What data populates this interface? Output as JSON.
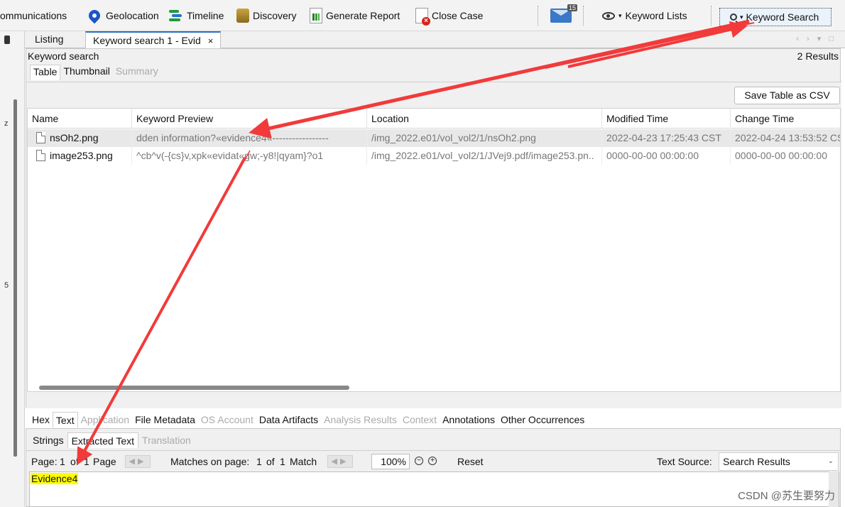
{
  "toolbar": {
    "items": [
      {
        "label": "ommunications",
        "icon": "communications-icon"
      },
      {
        "label": "Geolocation",
        "icon": "geolocation-pin-icon"
      },
      {
        "label": "Timeline",
        "icon": "timeline-icon"
      },
      {
        "label": "Discovery",
        "icon": "discovery-icon"
      },
      {
        "label": "Generate Report",
        "icon": "report-icon"
      },
      {
        "label": "Close Case",
        "icon": "close-case-icon"
      }
    ],
    "mail_badge": "15",
    "keyword_lists": "Keyword Lists",
    "keyword_search": "Keyword Search"
  },
  "left_strip": {
    "glyphs": [
      "z",
      "5"
    ]
  },
  "tabs": {
    "listing": "Listing",
    "active": "Keyword search 1 - Evid",
    "close": "×",
    "nav": "‹ › ▾ □"
  },
  "results": {
    "title": "Keyword search",
    "count": "2  Results",
    "subtabs": [
      {
        "label": "Table",
        "state": "active"
      },
      {
        "label": "Thumbnail",
        "state": "normal"
      },
      {
        "label": "Summary",
        "state": "disabled"
      }
    ],
    "save_csv": "Save Table as CSV",
    "columns": [
      "Name",
      "Keyword Preview",
      "Location",
      "Modified Time",
      "Change Time"
    ],
    "rows": [
      {
        "name": "nsOh2.png",
        "preview": "dden information?«evidence4«-----------------",
        "location": "/img_2022.e01/vol_vol2/1/nsOh2.png",
        "modified": "2022-04-23 17:25:43 CST",
        "changed": "2022-04-24 13:53:52 CS"
      },
      {
        "name": "image253.png",
        "preview": "^cb^v(-{cs}v,xpk«evidat«gw;-y8!|qyam}?o1",
        "location": "/img_2022.e01/vol_vol2/1/JVej9.pdf/image253.pn..",
        "modified": "0000-00-00 00:00:00",
        "changed": "0000-00-00 00:00:00"
      }
    ]
  },
  "viewer": {
    "tabs": [
      {
        "label": "Hex",
        "state": "normal"
      },
      {
        "label": "Text",
        "state": "active"
      },
      {
        "label": "Application",
        "state": "disabled"
      },
      {
        "label": "File Metadata",
        "state": "normal"
      },
      {
        "label": "OS Account",
        "state": "disabled"
      },
      {
        "label": "Data Artifacts",
        "state": "normal"
      },
      {
        "label": "Analysis Results",
        "state": "disabled"
      },
      {
        "label": "Context",
        "state": "disabled"
      },
      {
        "label": "Annotations",
        "state": "normal"
      },
      {
        "label": "Other Occurrences",
        "state": "normal"
      }
    ],
    "subtabs": [
      {
        "label": "Strings",
        "state": "normal"
      },
      {
        "label": "Extracted Text",
        "state": "active"
      },
      {
        "label": "Translation",
        "state": "disabled"
      }
    ],
    "page_label": "Page:",
    "page_current": "1",
    "page_of": "of",
    "page_total": "1",
    "page_unit": "Page",
    "matches_label": "Matches on page:",
    "match_current": "1",
    "match_of": "of",
    "match_total": "1",
    "match_unit": "Match",
    "zoom": "100%",
    "reset": "Reset",
    "text_source_label": "Text Source:",
    "text_source_value": "Search Results",
    "highlighted_text": "Evidence4",
    "highlight_color": "#ffff00"
  },
  "watermark": "CSDN @苏生要努力",
  "annotation_color": "#f23a3a"
}
